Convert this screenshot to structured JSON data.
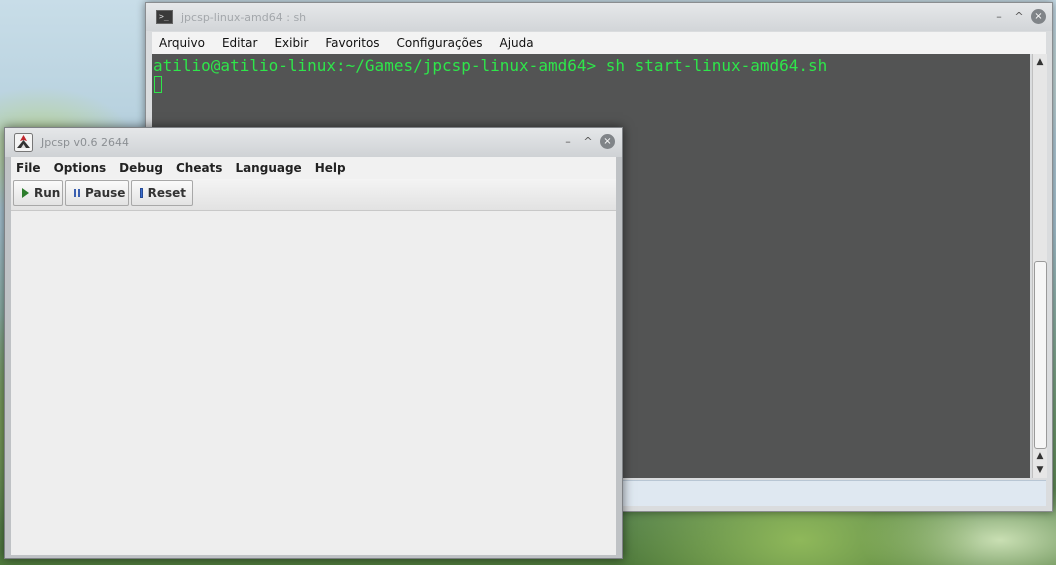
{
  "terminal": {
    "title": "jpcsp-linux-amd64 : sh",
    "icon": "terminal-icon",
    "menu": [
      "Arquivo",
      "Editar",
      "Exibir",
      "Favoritos",
      "Configurações",
      "Ajuda"
    ],
    "prompt_line": "atilio@atilio-linux:~/Games/jpcsp-linux-amd64> sh start-linux-amd64.sh",
    "text_color": "#2ee64a"
  },
  "jpcsp": {
    "title": "Jpcsp v0.6 2644",
    "menu": [
      "File",
      "Options",
      "Debug",
      "Cheats",
      "Language",
      "Help"
    ],
    "toolbar": {
      "run_label": "Run",
      "pause_label": "Pause",
      "reset_label": "Reset"
    }
  },
  "window_controls": {
    "minimize": "–",
    "maximize": "^",
    "close": "×"
  }
}
